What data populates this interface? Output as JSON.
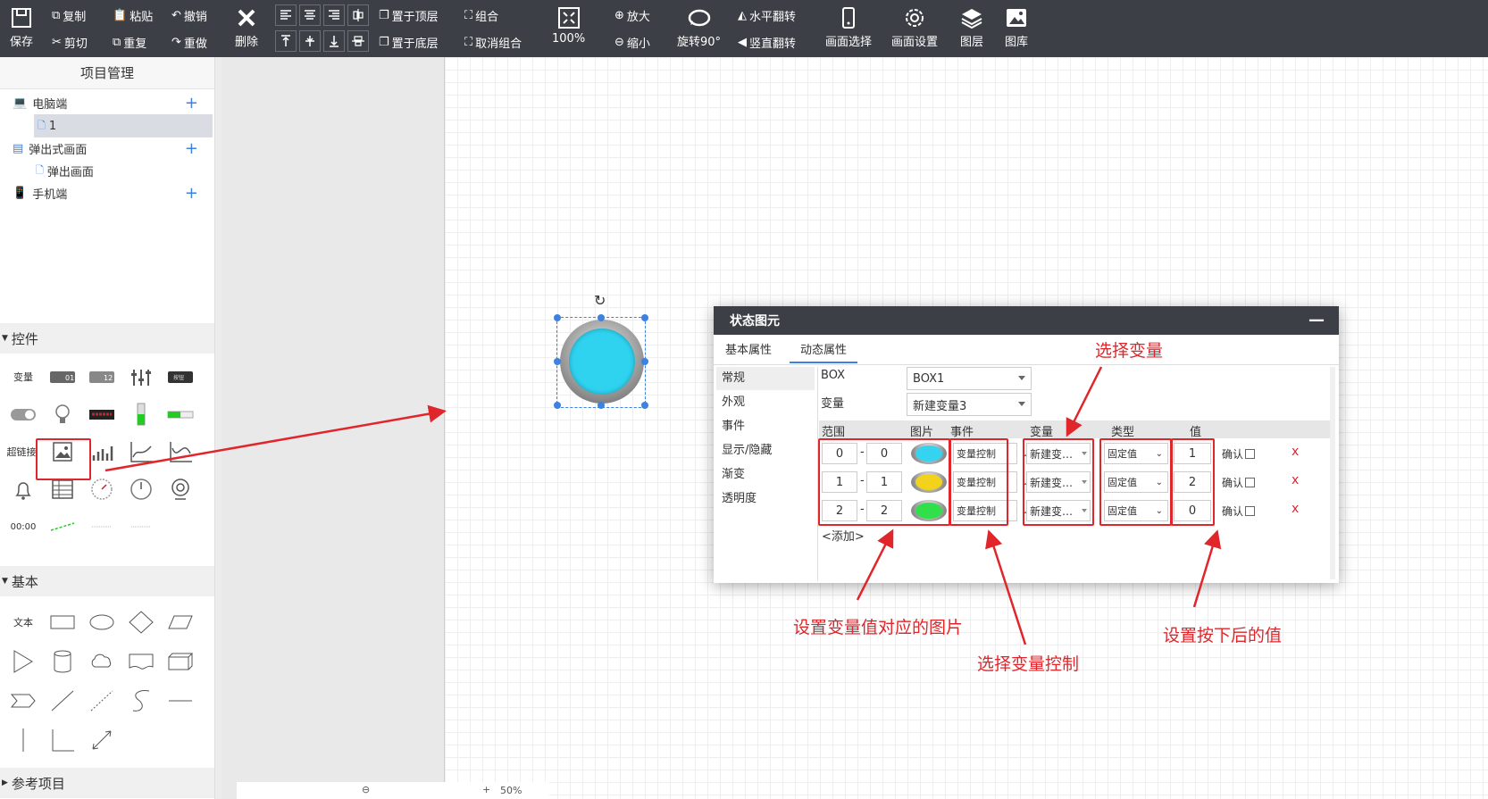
{
  "toolbar": {
    "save": "保存",
    "copy": "复制",
    "paste": "粘贴",
    "undo": "撤销",
    "cut": "剪切",
    "repeat": "重复",
    "redo": "重做",
    "delete": "删除",
    "bring_top": "置于顶层",
    "send_bottom": "置于底层",
    "group": "组合",
    "ungroup": "取消组合",
    "zoom_value": "100%",
    "zoom_in": "放大",
    "zoom_out": "缩小",
    "rotate": "旋转90°",
    "flip_h": "水平翻转",
    "flip_v": "竖直翻转",
    "screen_select": "画面选择",
    "screen_settings": "画面设置",
    "layers": "图层",
    "gallery": "图库"
  },
  "sidebar": {
    "title": "项目管理",
    "tree": [
      {
        "label": "电脑端",
        "has_add": true
      },
      {
        "label": "1",
        "has_add": false
      },
      {
        "label": "弹出式画面",
        "has_add": true
      },
      {
        "label": "弹出画面",
        "has_add": false
      },
      {
        "label": "手机端",
        "has_add": true
      }
    ],
    "sections": {
      "controls": "控件",
      "basic": "基本",
      "reference": "参考项目"
    },
    "widgets": {
      "variable": "变量",
      "hyperlink": "超链接",
      "clock": "00:00",
      "text": "文本",
      "num1": "01",
      "num2": "12",
      "btn": "按钮"
    }
  },
  "statusbar": {
    "zoom": "50%"
  },
  "dialog": {
    "title": "状态图元",
    "tabs": [
      "基本属性",
      "动态属性"
    ],
    "active_tab": "动态属性",
    "nav": [
      "常规",
      "外观",
      "事件",
      "显示/隐藏",
      "渐变",
      "透明度"
    ],
    "box_label": "BOX",
    "box_value": "BOX1",
    "var_label": "变量",
    "var_value": "新建变量3",
    "table_headers": [
      "范围",
      "图片",
      "事件",
      "变量",
      "类型",
      "值"
    ],
    "rows": [
      {
        "from": "0",
        "to": "0",
        "color": "#35d3f0",
        "event": "变量控制",
        "variable": "新建变…",
        "type": "固定值",
        "value": "1",
        "confirm": "确认",
        "delete": "x"
      },
      {
        "from": "1",
        "to": "1",
        "color": "#f2d21a",
        "event": "变量控制",
        "variable": "新建变…",
        "type": "固定值",
        "value": "2",
        "confirm": "确认",
        "delete": "x"
      },
      {
        "from": "2",
        "to": "2",
        "color": "#2fe04a",
        "event": "变量控制",
        "variable": "新建变…",
        "type": "固定值",
        "value": "0",
        "confirm": "确认",
        "delete": "x"
      }
    ],
    "add_label": "<添加>"
  },
  "annotations": {
    "select_variable": "选择变量",
    "set_image": "设置变量值对应的图片",
    "select_var_control": "选择变量控制",
    "set_value": "设置按下后的值"
  },
  "colors": {
    "toolbar_bg": "#3c3f45",
    "accent": "#3c82e0",
    "annotation": "#e0262b"
  }
}
